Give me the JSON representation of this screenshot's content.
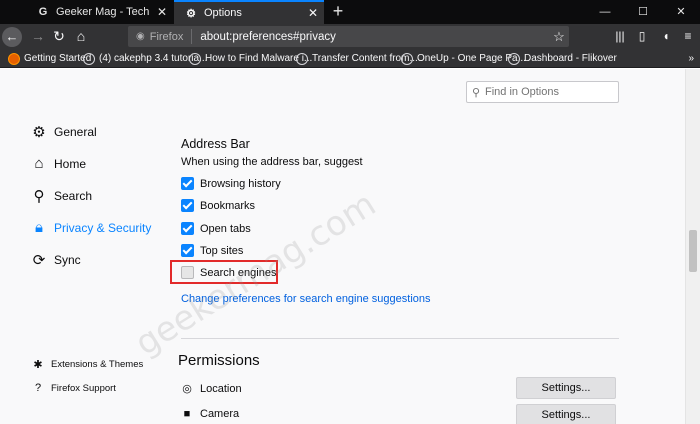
{
  "tabs": [
    {
      "icon": "G",
      "title": "Geeker Mag - Tech News and Ti"
    },
    {
      "icon": "⚙",
      "title": "Options"
    }
  ],
  "navbar": {
    "identity_label": "Firefox",
    "url": "about:preferences#privacy"
  },
  "bookmarks": [
    {
      "label": "Getting Started"
    },
    {
      "label": "(4) cakephp 3.4 tutoria..."
    },
    {
      "label": "How to Find Malware i..."
    },
    {
      "label": "Transfer Content from..."
    },
    {
      "label": "OneUp - One Page Pa..."
    },
    {
      "label": "Dashboard - Flikover"
    }
  ],
  "bookmarks_overflow": "»",
  "find": {
    "placeholder": "Find in Options"
  },
  "sidebar": {
    "items": [
      {
        "label": "General"
      },
      {
        "label": "Home"
      },
      {
        "label": "Search"
      },
      {
        "label": "Privacy & Security"
      },
      {
        "label": "Sync"
      }
    ],
    "footer": [
      {
        "label": "Extensions & Themes"
      },
      {
        "label": "Firefox Support"
      }
    ]
  },
  "address_bar": {
    "title": "Address Bar",
    "subtitle": "When using the address bar, suggest",
    "options": [
      {
        "label": "Browsing history",
        "checked": true
      },
      {
        "label": "Bookmarks",
        "checked": true
      },
      {
        "label": "Open tabs",
        "checked": true
      },
      {
        "label": "Top sites",
        "checked": true
      },
      {
        "label": "Search engines",
        "checked": false
      }
    ],
    "link": "Change preferences for search engine suggestions"
  },
  "permissions": {
    "title": "Permissions",
    "rows": [
      {
        "label": "Location",
        "button": "Settings..."
      },
      {
        "label": "Camera",
        "button": "Settings..."
      }
    ]
  },
  "watermark": "geekermag.com",
  "colors": {
    "accent": "#0a84ff",
    "highlight": "#e22a2a",
    "link": "#0060df"
  }
}
